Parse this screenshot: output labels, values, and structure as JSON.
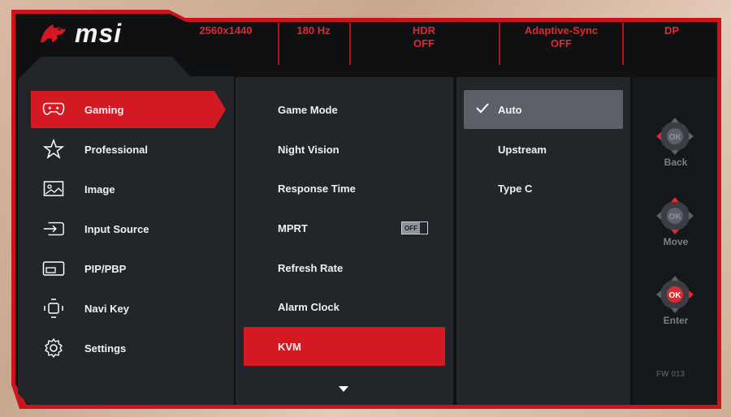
{
  "brand": {
    "name": "msi"
  },
  "status_bar": [
    {
      "line1": "2560x1440",
      "line2": ""
    },
    {
      "line1": "180 Hz",
      "line2": ""
    },
    {
      "line1": "HDR",
      "line2": "OFF"
    },
    {
      "line1": "Adaptive-Sync",
      "line2": "OFF"
    },
    {
      "line1": "DP",
      "line2": ""
    }
  ],
  "main_menu": {
    "selected_index": 0,
    "items": [
      {
        "label": "Gaming",
        "icon": "gamepad-icon"
      },
      {
        "label": "Professional",
        "icon": "star-icon"
      },
      {
        "label": "Image",
        "icon": "image-icon"
      },
      {
        "label": "Input Source",
        "icon": "input-source-icon"
      },
      {
        "label": "PIP/PBP",
        "icon": "pip-pbp-icon"
      },
      {
        "label": "Navi Key",
        "icon": "navi-key-icon"
      },
      {
        "label": "Settings",
        "icon": "gear-icon"
      }
    ]
  },
  "sub_menu": {
    "selected_index": 6,
    "items": [
      {
        "label": "Game Mode"
      },
      {
        "label": "Night Vision"
      },
      {
        "label": "Response Time"
      },
      {
        "label": "MPRT",
        "toggle": "OFF"
      },
      {
        "label": "Refresh Rate"
      },
      {
        "label": "Alarm Clock"
      },
      {
        "label": "KVM"
      }
    ],
    "more_indicator": "caret-down-icon"
  },
  "options": {
    "selected_index": 0,
    "items": [
      {
        "label": "Auto"
      },
      {
        "label": "Upstream"
      },
      {
        "label": "Type C"
      }
    ]
  },
  "navi_guide": [
    {
      "label": "Back",
      "highlight": "left",
      "icon": "navi-back-icon"
    },
    {
      "label": "Move",
      "highlight": "up-down",
      "icon": "navi-move-icon"
    },
    {
      "label": "Enter",
      "highlight": "right",
      "icon": "navi-enter-icon"
    }
  ],
  "firmware": "FW 013",
  "colors": {
    "accent": "#d31a22",
    "panel": "#22262b",
    "background": "#0e1012",
    "selected_option": "#5c6168"
  }
}
